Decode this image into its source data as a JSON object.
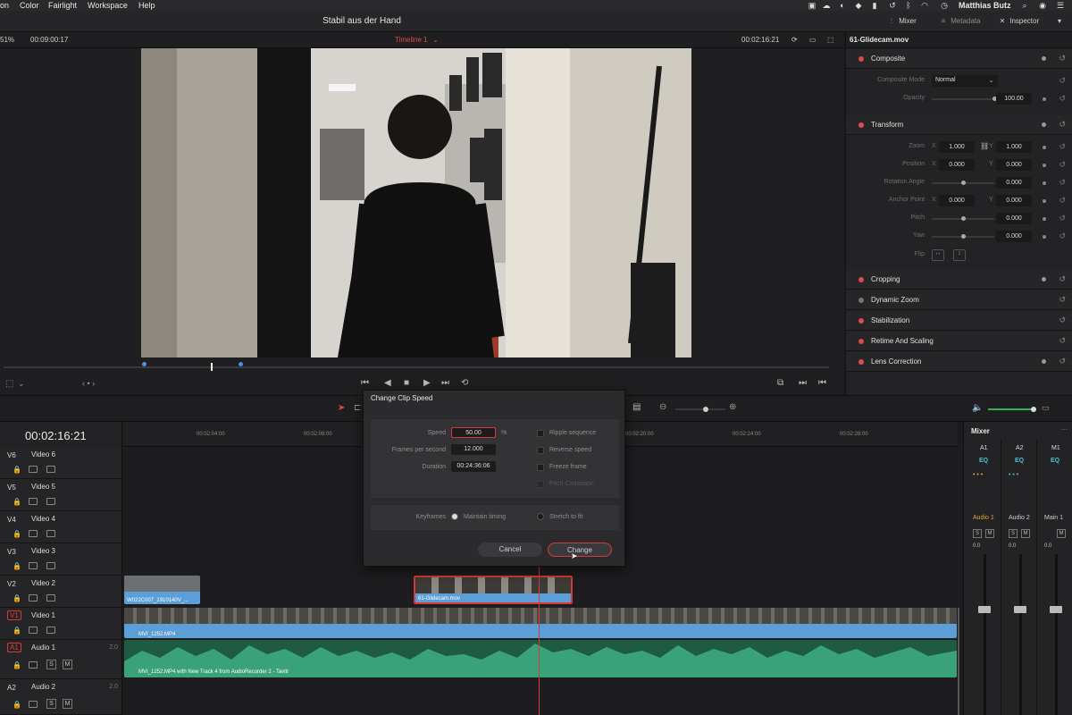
{
  "menubar": {
    "items": [
      "on",
      "Color",
      "Fairlight",
      "Workspace",
      "Help"
    ],
    "user": "Matthias Butz"
  },
  "titlebar": {
    "project_title": "Stabil aus der Hand",
    "mixer_label": "Mixer",
    "metadata_label": "Metadata",
    "inspector_label": "Inspector"
  },
  "viewer": {
    "zoom": "51%",
    "source_timecode": "00:09:00:17",
    "timeline_name": "Timeline 1",
    "record_timecode": "00:02:16:21"
  },
  "inspector": {
    "clip_name": "61-Glidecam.mov",
    "composite": {
      "label": "Composite",
      "mode_label": "Composite Mode",
      "mode_value": "Normal",
      "opacity_label": "Opacity",
      "opacity_value": "100.00"
    },
    "transform": {
      "label": "Transform",
      "zoom_label": "Zoom",
      "zoom_x": "1.000",
      "zoom_y": "1.000",
      "position_label": "Position",
      "position_x": "0.000",
      "position_y": "0.000",
      "rotation_label": "Rotation Angle",
      "rotation_value": "0.000",
      "anchor_label": "Anchor Point",
      "anchor_x": "0.000",
      "anchor_y": "0.000",
      "pitch_label": "Pitch",
      "pitch_value": "0.000",
      "yaw_label": "Yaw",
      "yaw_value": "0.000",
      "flip_label": "Flip",
      "x_axis": "X",
      "y_axis": "Y"
    },
    "sections": [
      {
        "label": "Cropping"
      },
      {
        "label": "Dynamic Zoom"
      },
      {
        "label": "Stabilization"
      },
      {
        "label": "Retime And Scaling"
      },
      {
        "label": "Lens Correction"
      }
    ]
  },
  "timeline": {
    "timecode": "00:02:16:21",
    "ruler_ticks": [
      "00:02:04:00",
      "00:02:08:00",
      "00:02:20:00",
      "00:02:24:00",
      "00:02:28:00"
    ],
    "tracks": [
      {
        "id": "V6",
        "name": "Video 6"
      },
      {
        "id": "V5",
        "name": "Video 5"
      },
      {
        "id": "V4",
        "name": "Video 4"
      },
      {
        "id": "V3",
        "name": "Video 3"
      },
      {
        "id": "V2",
        "name": "Video 2"
      },
      {
        "id": "V1",
        "name": "Video 1"
      },
      {
        "id": "A1",
        "name": "Audio 1",
        "channels": "2.0"
      },
      {
        "id": "A2",
        "name": "Audio 2",
        "channels": "2.0"
      }
    ],
    "clips": {
      "v2_left": "W022C007_1910140V_...",
      "v2_selected": "61-Glidecam.mov",
      "v1_main": "MVI_1252.MP4",
      "a1_main": "MVI_1252.MP4 with New Track 4 from AudioRecorder 2 - Tavitr"
    },
    "mute_label": "M",
    "solo_label": "S"
  },
  "mixer": {
    "title": "Mixer",
    "channels": [
      {
        "top": "A1",
        "eq": "EQ",
        "name": "Audio 1",
        "level": "0.0"
      },
      {
        "top": "A2",
        "eq": "EQ",
        "name": "Audio 2",
        "level": "0.0"
      },
      {
        "top": "M1",
        "eq": "EQ",
        "name": "Main 1",
        "level": "0.0"
      }
    ],
    "solo": "S",
    "mute": "M"
  },
  "dialog": {
    "title": "Change Clip Speed",
    "speed_label": "Speed",
    "speed_value": "50.00",
    "speed_unit": "%",
    "fps_label": "Frames per second",
    "fps_value": "12.000",
    "duration_label": "Duration",
    "duration_value": "00:24:36:06",
    "ripple_label": "Ripple sequence",
    "reverse_label": "Reverse speed",
    "freeze_label": "Freeze frame",
    "pitch_label": "Pitch Correction",
    "keyframes_label": "Keyframes",
    "maintain_label": "Maintain timing",
    "stretch_label": "Stretch to fit",
    "cancel_label": "Cancel",
    "change_label": "Change"
  },
  "colors": {
    "accent_red": "#e24a4a",
    "clip_blue": "#5b9fd6",
    "audio_green": "#3aa27b",
    "selection_red": "#d93838"
  }
}
